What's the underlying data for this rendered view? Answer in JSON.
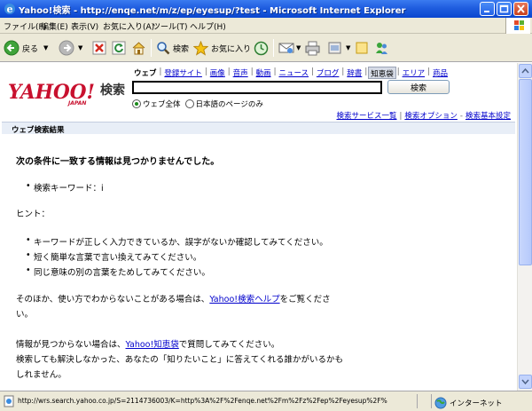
{
  "window": {
    "title": "Yahoo!検索 - http://enqe.net/m/z/ep/eyesup/?test - Microsoft Internet Explorer"
  },
  "menu": [
    "ファイル(F)",
    "編集(E)",
    "表示(V)",
    "お気に入り(A)",
    "ツール(T)",
    "ヘルプ(H)"
  ],
  "toolbar": {
    "back_label": "戻る",
    "search_label": "検索",
    "favorites_label": "お気に入り"
  },
  "header": {
    "logo": "YAHOO!",
    "logo_sub": "JAPAN",
    "search_word": "検索",
    "categories": [
      "ウェブ",
      "登録サイト",
      "画像",
      "音声",
      "動画",
      "ニュース",
      "ブログ",
      "辞書",
      "知恵袋",
      "エリア",
      "商品"
    ],
    "search_value": "",
    "search_button": "検索",
    "scope_all": "ウェブ全体",
    "scope_ja": "日本語のページのみ",
    "links": [
      "検索サービス一覧",
      "検索オプション",
      "検索基本設定"
    ]
  },
  "results": {
    "bar_title": "ウェブ検索結果",
    "heading": "次の条件に一致する情報は見つかりませんでした。",
    "keyword_item": "検索キーワード：i",
    "hint_label": "ヒント：",
    "hints": [
      "キーワードが正しく入力できているか、誤字がないか確認してみてください。",
      "短く簡単な言葉で言い換えてみてください。",
      "同じ意味の別の言葉をためしてみてください。"
    ],
    "help_pre": "そのほか、使い方でわからないことがある場合は、",
    "help_link": "Yahoo!検索ヘルプ",
    "help_post": "をご覧くださ",
    "help_post2": "い。",
    "chie_pre": "情報が見つからない場合は、",
    "chie_link": "Yahoo!知恵袋",
    "chie_post": "で質問してみてください。",
    "chie_line2": "検索しても解決しなかった、あなたの「知りたいこと」に答えてくれる誰かがいるかも",
    "chie_line3": "しれません。"
  },
  "status": {
    "url": "http://wrs.search.yahoo.co.jp/S=2114736003/K=http%3A%2F%2Fenqe.net%2Fm%2Fz%2Fep%2Feyesup%2F%",
    "zone": "インターネット"
  }
}
